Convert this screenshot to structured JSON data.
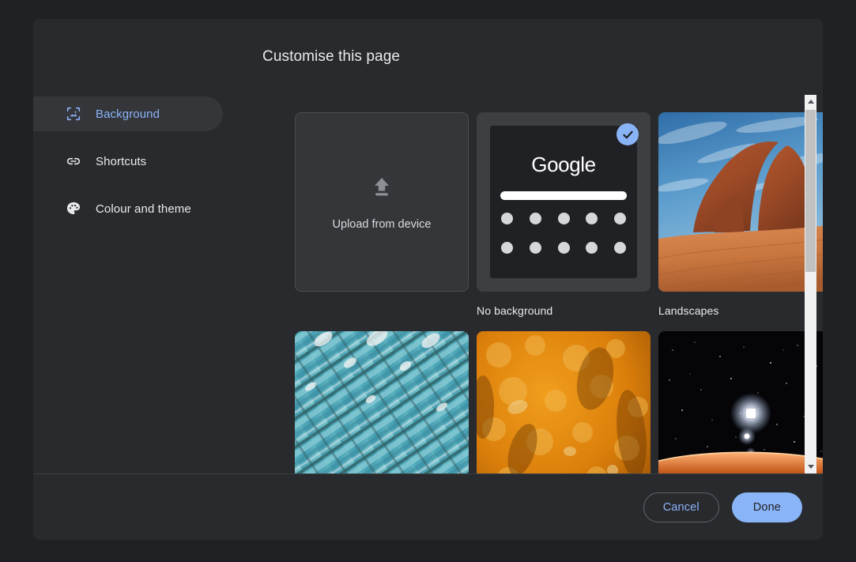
{
  "dialog": {
    "title": "Customise this page"
  },
  "sidebar": {
    "items": [
      {
        "label": "Background",
        "icon": "image-frame-icon",
        "selected": true
      },
      {
        "label": "Shortcuts",
        "icon": "link-icon",
        "selected": false
      },
      {
        "label": "Colour and theme",
        "icon": "palette-icon",
        "selected": false
      }
    ]
  },
  "tiles": [
    {
      "kind": "upload",
      "label": "Upload from device",
      "icon": "upload-arrow-icon",
      "selected": false
    },
    {
      "kind": "no-background",
      "label": "No background",
      "selected": true,
      "mock": {
        "logo_text": "Google",
        "searchbar": true,
        "dot_rows": 2,
        "dots_per_row": 5
      }
    },
    {
      "kind": "photo",
      "label": "Landscapes",
      "selected": false,
      "image": "delicate-arch-red-rock-blue-sky"
    },
    {
      "kind": "photo",
      "label": "",
      "selected": false,
      "image": "teal-glass-facade-diagonal-pattern"
    },
    {
      "kind": "photo",
      "label": "",
      "selected": false,
      "image": "amber-orange-mottled-texture"
    },
    {
      "kind": "photo",
      "label": "",
      "selected": false,
      "image": "starfield-over-orange-planet-horizon"
    }
  ],
  "scrollbar": {
    "up_arrow": "scroll-up-arrow",
    "down_arrow": "scroll-down-arrow"
  },
  "footer": {
    "cancel_label": "Cancel",
    "done_label": "Done"
  },
  "colors": {
    "accent": "#8ab4f8",
    "dialog_bg": "#292a2d",
    "page_bg": "#202124",
    "text": "#e8eaed"
  }
}
